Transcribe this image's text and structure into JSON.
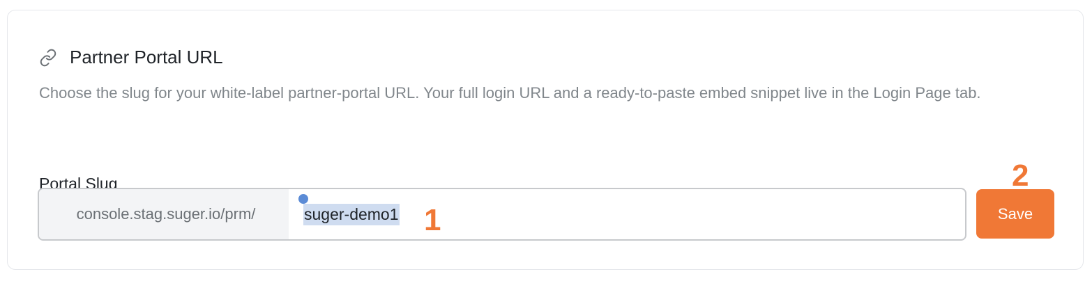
{
  "section": {
    "icon": "link-icon",
    "title": "Partner Portal URL",
    "description": "Choose the slug for your white-label partner-portal URL. Your full login URL and a ready-to-paste embed snippet live in the Login Page tab."
  },
  "field": {
    "label": "Portal Slug",
    "prefix": "console.stag.suger.io/prm/",
    "value": "suger-demo1"
  },
  "save_button": {
    "label": "Save"
  },
  "annotations": {
    "first": "1",
    "second": "2"
  },
  "colors": {
    "accent": "#f07836",
    "selection": "#cfdcf0",
    "caret": "#5b8bd6"
  }
}
